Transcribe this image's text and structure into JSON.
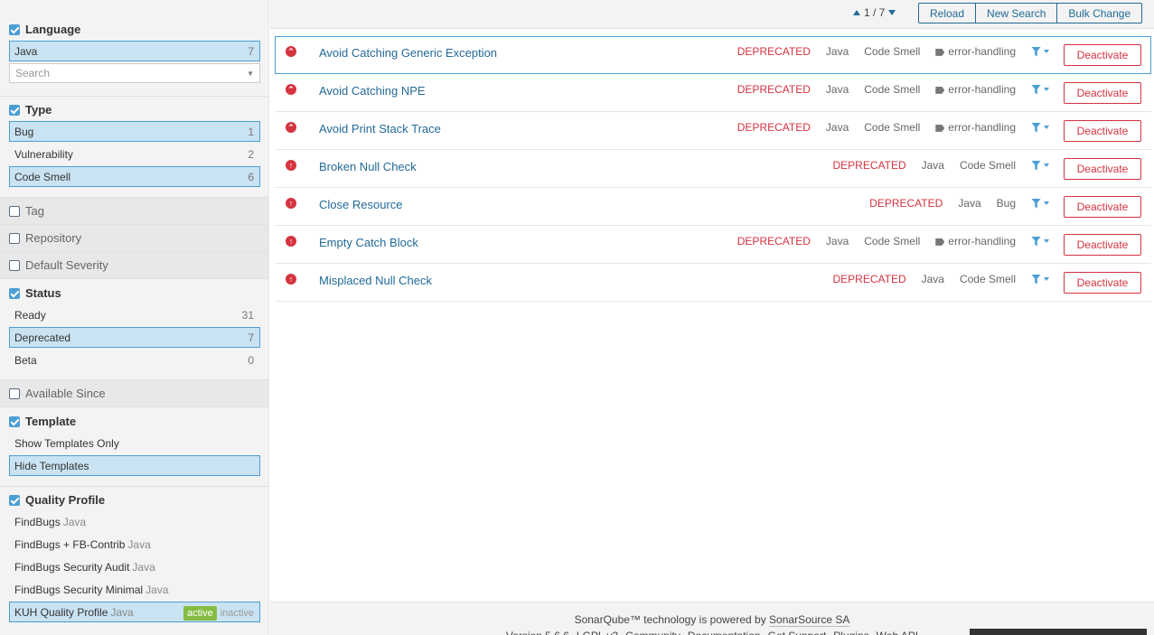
{
  "sidebar": {
    "language": {
      "title": "Language",
      "items": [
        {
          "label": "Java",
          "count": "7"
        }
      ],
      "search_placeholder": "Search"
    },
    "type": {
      "title": "Type",
      "items": [
        {
          "label": "Bug",
          "count": "1"
        },
        {
          "label": "Vulnerability",
          "count": "2"
        },
        {
          "label": "Code Smell",
          "count": "6"
        }
      ]
    },
    "tag": {
      "title": "Tag"
    },
    "repository": {
      "title": "Repository"
    },
    "default_severity": {
      "title": "Default Severity"
    },
    "status": {
      "title": "Status",
      "items": [
        {
          "label": "Ready",
          "count": "31"
        },
        {
          "label": "Deprecated",
          "count": "7"
        },
        {
          "label": "Beta",
          "count": "0"
        }
      ]
    },
    "available_since": {
      "title": "Available Since"
    },
    "template": {
      "title": "Template",
      "items": [
        {
          "label": "Show Templates Only"
        },
        {
          "label": "Hide Templates"
        }
      ]
    },
    "quality_profile": {
      "title": "Quality Profile",
      "items": [
        {
          "label": "FindBugs",
          "lang": "Java"
        },
        {
          "label": "FindBugs + FB-Contrib",
          "lang": "Java"
        },
        {
          "label": "FindBugs Security Audit",
          "lang": "Java"
        },
        {
          "label": "FindBugs Security Minimal",
          "lang": "Java"
        },
        {
          "label": "KUH Quality Profile",
          "lang": "Java"
        }
      ],
      "active_label": "active",
      "inactive_label": "inactive"
    }
  },
  "topbar": {
    "pager": "1 / 7",
    "reload": "Reload",
    "new_search": "New Search",
    "bulk_change": "Bulk Change"
  },
  "rules": [
    {
      "name": "Avoid Catching Generic Exception",
      "status": "DEPRECATED",
      "lang": "Java",
      "type": "Code Smell",
      "tag": "error-handling",
      "severity_icon": "major-icon"
    },
    {
      "name": "Avoid Catching NPE",
      "status": "DEPRECATED",
      "lang": "Java",
      "type": "Code Smell",
      "tag": "error-handling",
      "severity_icon": "major-icon"
    },
    {
      "name": "Avoid Print Stack Trace",
      "status": "DEPRECATED",
      "lang": "Java",
      "type": "Code Smell",
      "tag": "error-handling",
      "severity_icon": "major-icon"
    },
    {
      "name": "Broken Null Check",
      "status": "DEPRECATED",
      "lang": "Java",
      "type": "Code Smell",
      "tag": "",
      "severity_icon": "critical-icon"
    },
    {
      "name": "Close Resource",
      "status": "DEPRECATED",
      "lang": "Java",
      "type": "Bug",
      "tag": "",
      "severity_icon": "critical-icon"
    },
    {
      "name": "Empty Catch Block",
      "status": "DEPRECATED",
      "lang": "Java",
      "type": "Code Smell",
      "tag": "error-handling",
      "severity_icon": "critical-icon"
    },
    {
      "name": "Misplaced Null Check",
      "status": "DEPRECATED",
      "lang": "Java",
      "type": "Code Smell",
      "tag": "",
      "severity_icon": "critical-icon"
    }
  ],
  "deactivate_label": "Deactivate",
  "footer": {
    "text": "SonarQube™ technology is powered by",
    "link": "SonarSource SA",
    "line2": [
      "Version 5.6.6",
      "LGPL v3",
      "Community",
      "Documentation",
      "Get Support",
      "Plugins",
      "Web API"
    ]
  }
}
